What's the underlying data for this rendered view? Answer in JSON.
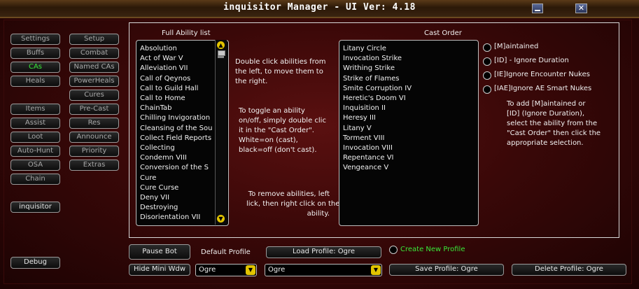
{
  "window": {
    "title": "inquisitor Manager   - UI Ver: 4.18",
    "minimize_icon": "minimize-icon",
    "close_icon": "close-icon",
    "close_glyph": "✕"
  },
  "nav": {
    "col1": [
      {
        "label": "Settings"
      },
      {
        "label": "Buffs"
      },
      {
        "label": "CAs",
        "active": true
      },
      {
        "label": "Heals"
      },
      {
        "label": "Items"
      },
      {
        "label": "Assist"
      },
      {
        "label": "Loot"
      },
      {
        "label": "Auto-Hunt"
      },
      {
        "label": "OSA"
      },
      {
        "label": "Chain"
      }
    ],
    "col2": [
      {
        "label": "Setup"
      },
      {
        "label": "Combat"
      },
      {
        "label": "Named CAs"
      },
      {
        "label": "PowerHeals"
      },
      {
        "label": "Cures"
      },
      {
        "label": "Pre-Cast"
      },
      {
        "label": "Res"
      },
      {
        "label": "Announce"
      },
      {
        "label": "Priority"
      },
      {
        "label": "Extras"
      }
    ],
    "character": "inquisitor",
    "debug": "Debug"
  },
  "ability_list": {
    "title": "Full Ability list",
    "items": [
      "Absolution",
      "Act of War V",
      "Alleviation VII",
      "Call of Qeynos",
      "Call to Guild Hall",
      "Call to Home",
      "ChainTab",
      "Chilling Invigoration",
      "Cleansing of the Sou",
      "Collect Field Reports",
      "Collecting",
      "Condemn VIII",
      "Conversion of the S",
      "Cure",
      "Cure Curse",
      "Deny VII",
      "Destroying",
      "Disorientation VII"
    ]
  },
  "help_left": {
    "line1": [
      "Double click abilities from",
      "the left, to move them to",
      "the right."
    ],
    "line2": [
      "To toggle an ability",
      "on/off, simply double clic",
      "it in the \"Cast Order\".",
      "White=on (cast),",
      "black=off (don't cast)."
    ],
    "line3": [
      "To remove abilities, left",
      "lick, then right click on the",
      "ability."
    ]
  },
  "cast_order": {
    "title": "Cast Order",
    "items": [
      "Litany Circle",
      "Invocation Strike",
      "Writhing Strike",
      "Strike of Flames",
      "Smite Corruption IV",
      "Heretic's Doom VI",
      "Inquisition II",
      "Heresy III",
      "Litany V",
      "Torment VIII",
      "Invocation VIII",
      "Repentance VI",
      "Vengeance V"
    ]
  },
  "options": [
    {
      "label": "[M]aintained"
    },
    {
      "label": "[ID] - Ignore Duration"
    },
    {
      "label": "[IE]Ignore Encounter Nukes"
    },
    {
      "label": "[IAE]Ignore AE Smart Nukes"
    }
  ],
  "help_right": [
    "To add [M]aintained or",
    "[ID] (Ignore Duration),",
    "select the ability from the",
    "\"Cast Order\" then click the",
    "appropriate selection."
  ],
  "bottom": {
    "pause_bot": "Pause Bot",
    "hide_mini": "Hide Mini Wdw",
    "default_profile_label": "Default Profile",
    "load_profile": "Load Profile: Ogre",
    "create_profile": "Create New Profile",
    "profile_dropdown_1": "Ogre",
    "profile_dropdown_2": "Ogre",
    "save_profile": "Save Profile: Ogre",
    "delete_profile": "Delete Profile: Ogre"
  },
  "colors": {
    "accent_green": "#39e839",
    "scroll_yellow": "#e2c400"
  }
}
